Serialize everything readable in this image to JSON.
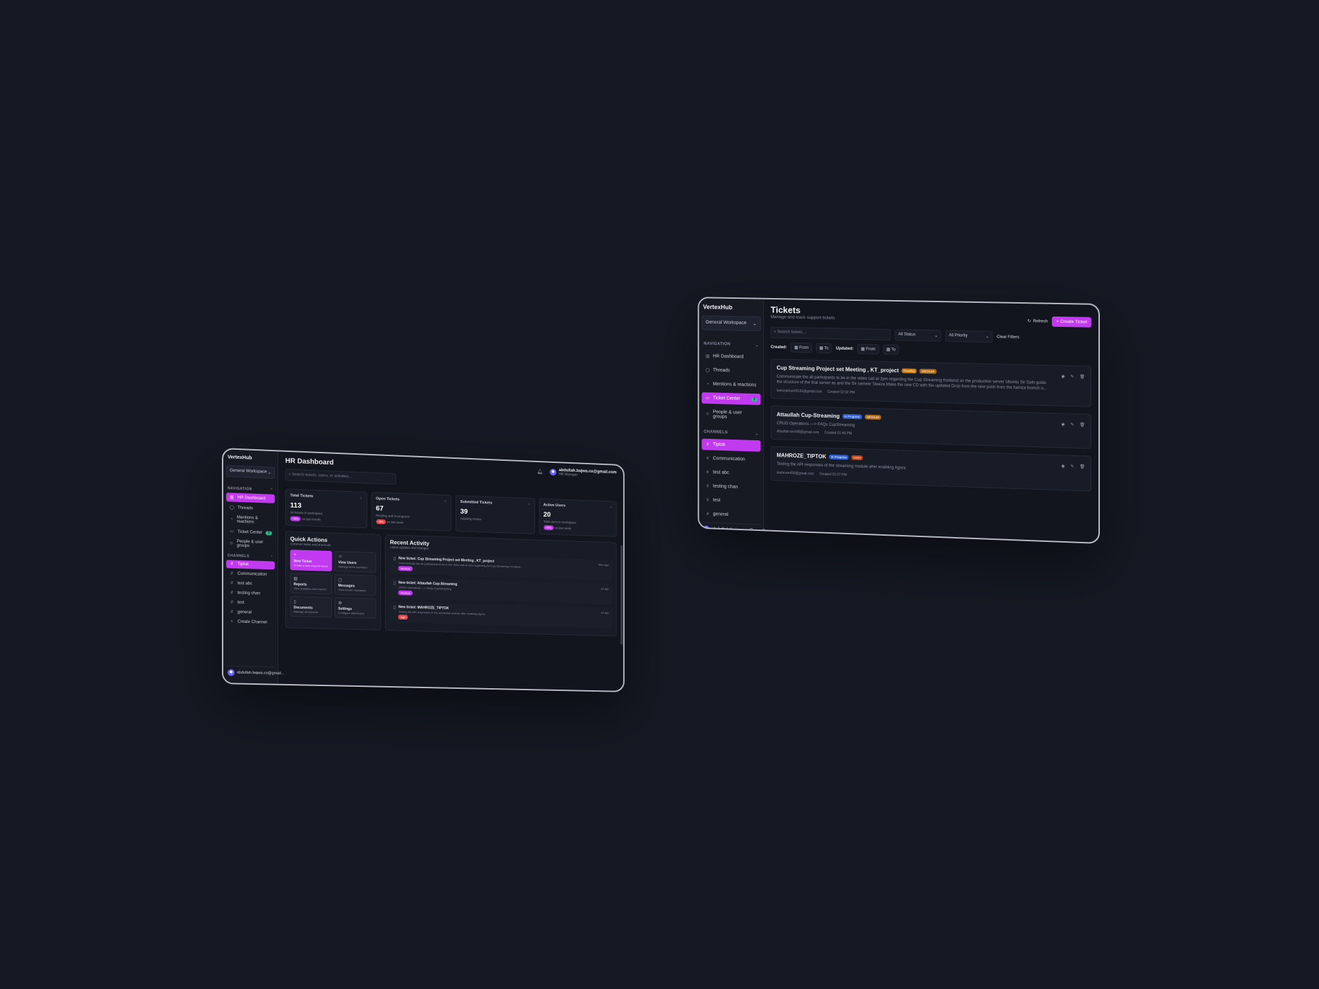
{
  "hr": {
    "brand": "VertexHub",
    "workspace": "General Workspace",
    "nav_section": "NAVIGATION",
    "channels_section": "CHANNELS",
    "nav": [
      {
        "label": "HR Dashboard",
        "icon": "dashboard-icon",
        "active": true
      },
      {
        "label": "Threads",
        "icon": "threads-icon"
      },
      {
        "label": "Mentions & reactions",
        "icon": "bell-icon"
      },
      {
        "label": "Ticket Center",
        "icon": "ticket-icon",
        "badge": "8"
      },
      {
        "label": "People & user groups",
        "icon": "users-icon"
      }
    ],
    "channels": [
      "Tiptok",
      "Communication",
      "test abc",
      "testing chan",
      "test",
      "general"
    ],
    "create_channel": "Create Channel",
    "user_email_short": "abdullah.bajwa.co@gmail...",
    "title": "HR Dashboard",
    "search_placeholder": "Search tickets, users, or activities...",
    "user_email": "abdullah.bajwa.co@gmail.com",
    "user_role": "HR Manager",
    "stats": [
      {
        "label": "Total Tickets",
        "value": "113",
        "sub": "All tickets in workspace",
        "change": "+8%",
        "change_note": "vs last month",
        "change_color": "#c13af0"
      },
      {
        "label": "Open Tickets",
        "value": "67",
        "sub": "Pending and in progress",
        "change": "-3%",
        "change_note": "vs last week",
        "change_color": "#e5484d"
      },
      {
        "label": "Submitted Tickets",
        "value": "39",
        "sub": "Awaiting review"
      },
      {
        "label": "Active Users",
        "value": "20",
        "sub": "Total users in workspace",
        "change": "+6%",
        "change_note": "vs last week",
        "change_color": "#c13af0"
      }
    ],
    "quick_actions_title": "Quick Actions",
    "quick_actions_sub": "Common tasks and shortcuts",
    "quick_actions": [
      {
        "label": "New Ticket",
        "desc": "Create a new support ticket",
        "icon": "plus-icon",
        "highlight": true
      },
      {
        "label": "View Users",
        "desc": "Manage team members",
        "icon": "users-icon"
      },
      {
        "label": "Reports",
        "desc": "View analytics and reports",
        "icon": "chart-icon"
      },
      {
        "label": "Messages",
        "desc": "View recent messages",
        "icon": "message-icon"
      },
      {
        "label": "Documents",
        "desc": "Manage documents",
        "icon": "document-icon"
      },
      {
        "label": "Settings",
        "desc": "Configure dashboard",
        "icon": "gear-icon"
      }
    ],
    "activity_title": "Recent Activity",
    "activity_sub": "Latest updates and changes",
    "activity": [
      {
        "title": "New ticket: Cup Streaming Project set Meeting , KT_project",
        "desc": "Communicate the all participants to be in the video call at 2pm regarding the Cup Streaming Frontend...",
        "tag": "medium",
        "tag_color": "#c13af0",
        "time": "5hrs ago"
      },
      {
        "title": "New ticket: Attaullah Cup-Streaming",
        "desc": "CRUD Operations ---> FAQs CupStreaming",
        "tag": "medium",
        "tag_color": "#c13af0",
        "time": "1d ago"
      },
      {
        "title": "New ticket: MAHROZE_TIPTOK",
        "desc": "Testing the API responses of the streaming module after enabling Agora",
        "tag": "high",
        "tag_color": "#e5484d",
        "time": "1d ago"
      }
    ]
  },
  "tickets": {
    "brand": "VertexHub",
    "workspace": "General Workspace",
    "nav_section": "NAVIGATION",
    "channels_section": "CHANNELS",
    "nav": [
      {
        "label": "HR Dashboard",
        "icon": "dashboard-icon"
      },
      {
        "label": "Threads",
        "icon": "threads-icon"
      },
      {
        "label": "Mentions & reactions",
        "icon": "bell-icon"
      },
      {
        "label": "Ticket Center",
        "icon": "ticket-icon",
        "badge": "8",
        "active": true
      },
      {
        "label": "People & user groups",
        "icon": "users-icon"
      }
    ],
    "channels": [
      "Tiptok",
      "Communication",
      "test abc",
      "testing chan",
      "test",
      "general"
    ],
    "user_email_short": "abdullah.bajwa.co@gmail...",
    "title": "Tickets",
    "subtitle": "Manage and track support tickets",
    "refresh": "Refresh",
    "create": "Create Ticket",
    "search_placeholder": "Search tickets...",
    "status_select": "All Status",
    "priority_select": "All Priority",
    "clear_filters": "Clear Filters",
    "created_label": "Created:",
    "updated_label": "Updated:",
    "from": "From",
    "to": "To",
    "items": [
      {
        "name": "Cup Streaming Project set Meeting , KT_project",
        "status": "Pending",
        "status_color": "#c9790d",
        "priority": "MEDIUM",
        "priority_color": "#b36a12",
        "desc": "Communicate the all participants to be in the video call at 2pm regarding the Cup Streaming frontend on the production server Ubuntu Sir Salh guide the structure of the that server as and the Sir sameer Steeze,Make the new CD with the updated Drop from the new push from the hamza branch o...",
        "email": "hamzakhan09191@gmail.com",
        "created": "Created 02:02 PM"
      },
      {
        "name": "Attaullah Cup-Streaming",
        "status": "In Progress",
        "status_color": "#2f5fd0",
        "priority": "MEDIUM",
        "priority_color": "#b36a12",
        "desc": "CRUD Operations ---> FAQs CupStreaming",
        "email": "attaullah.tech98@gmail.com",
        "created": "Created 01:46 PM"
      },
      {
        "name": "MAHROZE_TIPTOK",
        "status": "In Progress",
        "status_color": "#2f5fd0",
        "priority": "HIGH",
        "priority_color": "#c2410c",
        "desc": "Testing the API responses of the streaming module after enabling Agora",
        "email": "mahroze430@gmail.com",
        "created": "Created 01:07 PM"
      }
    ]
  }
}
